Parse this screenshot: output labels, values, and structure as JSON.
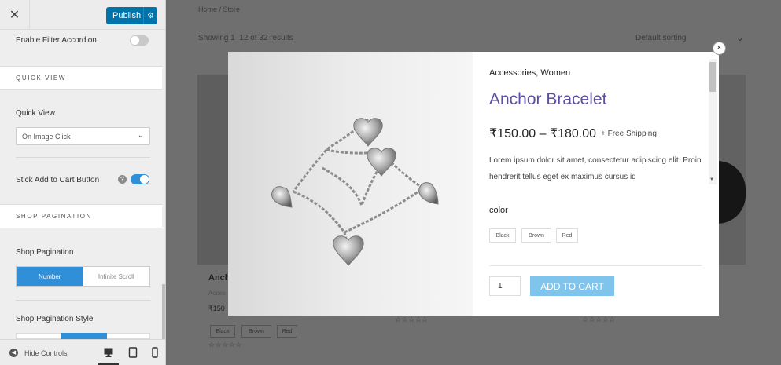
{
  "customizer": {
    "close_label": "✕",
    "publish_label": "Publish",
    "publish_gear": "⚙",
    "enable_filter_accordion_label": "Enable Filter Accordion",
    "quick_view_section": "QUICK VIEW",
    "quick_view_label": "Quick View",
    "quick_view_value": "On Image Click",
    "stick_add_to_cart_label": "Stick Add to Cart Button",
    "shop_pagination_section": "SHOP PAGINATION",
    "shop_pagination_label": "Shop Pagination",
    "pagination_options": [
      "Number",
      "Infinite Scroll"
    ],
    "pagination_selected": "Number",
    "shop_pagination_style_label": "Shop Pagination Style",
    "hide_controls_label": "Hide Controls",
    "toggles": {
      "enable_filter_accordion": false,
      "stick_add_to_cart": true
    },
    "accent_color": "#2f8fd8"
  },
  "store": {
    "breadcrumb": "Home / Store",
    "results_text": "Showing 1–12 of 32 results",
    "sorting_value": "Default sorting",
    "product_title_partial": "Anch",
    "product_category_partial": "Acces",
    "product_price_partial": "₹150",
    "colors": [
      "Black",
      "Brown",
      "Red"
    ],
    "stars": "☆☆☆☆☆"
  },
  "quick_view": {
    "close_label": "×",
    "categories": "Accessories, Women",
    "title": "Anchor Bracelet",
    "price": "₹150.00 – ₹180.00",
    "shipping": "+ Free Shipping",
    "description": "Lorem ipsum dolor sit amet, consectetur adipiscing elit. Proin hendrerit tellus eget ex maximus cursus id",
    "color_label": "color",
    "colors": [
      "Black",
      "Brown",
      "Red"
    ],
    "quantity": "1",
    "add_to_cart_label": "ADD TO CART",
    "title_color": "#5b4fa3",
    "button_color": "#7ec4ec"
  }
}
